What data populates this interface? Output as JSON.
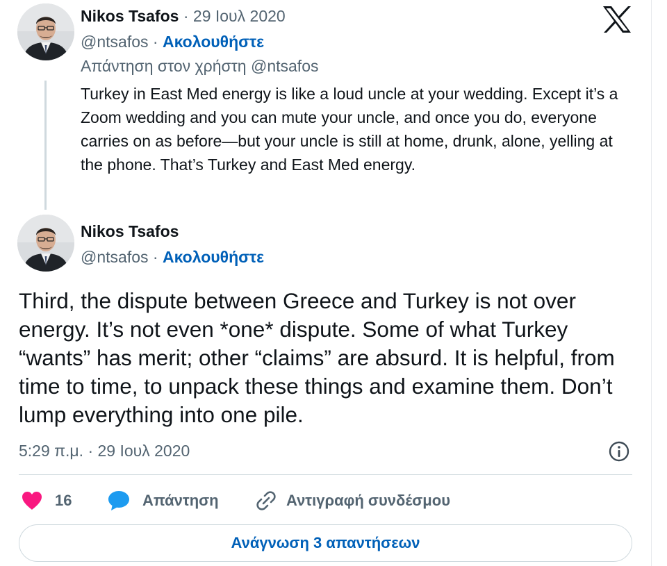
{
  "brand": {
    "logo_icon": "x-logo-icon",
    "accent_color": "#0060b8",
    "like_color": "#f91880",
    "reply_color": "#1d9bf0"
  },
  "parent_tweet": {
    "author_name": "Nikos Tsafos",
    "separator": "·",
    "date": "29 Ιουλ 2020",
    "handle": "@ntsafos",
    "dot": "·",
    "follow_label": "Ακολουθήστε",
    "reply_prefix": "Απάντηση στον χρήστη",
    "reply_handle": "@ntsafos",
    "text": "Turkey in East Med energy is like a loud uncle at your wedding. Except it’s a Zoom wedding and you can mute your uncle, and once you do, everyone carries on as before—but your uncle is still at home, drunk, alone, yelling at the phone. That’s Turkey and East Med energy."
  },
  "main_tweet": {
    "author_name": "Nikos Tsafos",
    "handle": "@ntsafos",
    "dot": "·",
    "follow_label": "Ακολουθήστε",
    "text": "Third, the dispute between Greece and Turkey is not over energy. It’s not even *one* dispute. Some of what Turkey “wants” has merit; other “claims” are absurd. It is helpful, from time to time, to unpack these things and examine them. Don’t lump everything into one pile.",
    "timestamp": "5:29 π.μ. · 29 Ιουλ 2020"
  },
  "actions": {
    "like_count": "16",
    "reply_label": "Απάντηση",
    "copy_link_label": "Αντιγραφή συνδέσμου"
  },
  "read_replies_label": "Ανάγνωση 3 απαντήσεων"
}
